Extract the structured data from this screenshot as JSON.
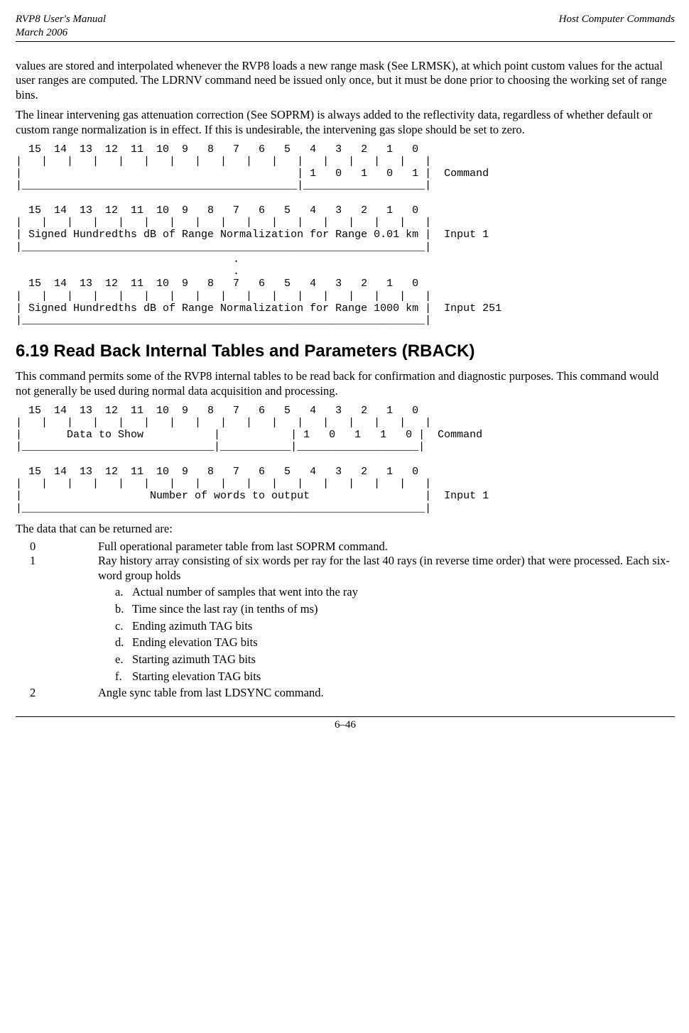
{
  "header": {
    "title_line1": "RVP8 User's Manual",
    "title_line2": "March 2006",
    "right": "Host Computer Commands"
  },
  "para1": "values are stored and interpolated whenever the RVP8 loads a new range mask (See LRMSK), at which point custom values for the actual user ranges are computed.  The LDRNV command need be issued only once, but it must be done prior to choosing the working set of range bins.",
  "para2": "The linear intervening gas attenuation correction (See SOPRM) is always added to the reflectivity data, regardless of whether default or custom range normalization is in effect.  If this is undesirable, the intervening gas slope should be set to zero.",
  "diagram1": "  15  14  13  12  11  10  9   8   7   6   5   4   3   2   1   0 \n|   |   |   |   |   |   |   |   |   |   |   |   |   |   |   |   |\n|                                           | 1   0   1   0   1 |  Command\n|___________________________________________|___________________|\n\n  15  14  13  12  11  10  9   8   7   6   5   4   3   2   1   0 \n|   |   |   |   |   |   |   |   |   |   |   |   |   |   |   |   |\n| Signed Hundredths dB of Range Normalization for Range 0.01 km |  Input 1\n|_______________________________________________________________|\n                                  .\n                                  .\n  15  14  13  12  11  10  9   8   7   6   5   4   3   2   1   0 \n|   |   |   |   |   |   |   |   |   |   |   |   |   |   |   |   |\n| Signed Hundredths dB of Range Normalization for Range 1000 km |  Input 251\n|_______________________________________________________________|",
  "section_heading": "6.19     Read Back Internal Tables and Parameters (RBACK)",
  "para3": "This command permits some of the RVP8 internal tables to be read back for confirmation and diagnostic purposes.  This command would not generally be used during normal data acquisition and processing.",
  "diagram2": "  15  14  13  12  11  10  9   8   7   6   5   4   3   2   1   0 \n|   |   |   |   |   |   |   |   |   |   |   |   |   |   |   |   |\n|       Data to Show           |           | 1   0   1   1   0 |  Command\n|______________________________|___________|___________________|\n\n  15  14  13  12  11  10  9   8   7   6   5   4   3   2   1   0 \n|   |   |   |   |   |   |   |   |   |   |   |   |   |   |   |   |\n|                    Number of words to output                  |  Input 1\n|_______________________________________________________________|",
  "para4": "The data that can be returned are:",
  "list": {
    "items": [
      {
        "key": "0",
        "val": "Full operational parameter table from last SOPRM command."
      },
      {
        "key": "1",
        "val": "Ray history array consisting of six words per ray for the last 40 rays (in reverse time order) that were processed.  Each six-word group holds"
      },
      {
        "key": "2",
        "val": "Angle sync table from last LDSYNC command."
      }
    ],
    "sub": [
      {
        "letter": "a.",
        "text": "Actual number of samples that went into the ray"
      },
      {
        "letter": "b.",
        "text": "Time since the last ray (in tenths of ms)"
      },
      {
        "letter": "c.",
        "text": "Ending azimuth TAG bits"
      },
      {
        "letter": "d.",
        "text": "Ending elevation TAG bits"
      },
      {
        "letter": "e.",
        "text": "Starting azimuth TAG bits"
      },
      {
        "letter": "f.",
        "text": "Starting elevation TAG bits"
      }
    ]
  },
  "footer": "6–46"
}
